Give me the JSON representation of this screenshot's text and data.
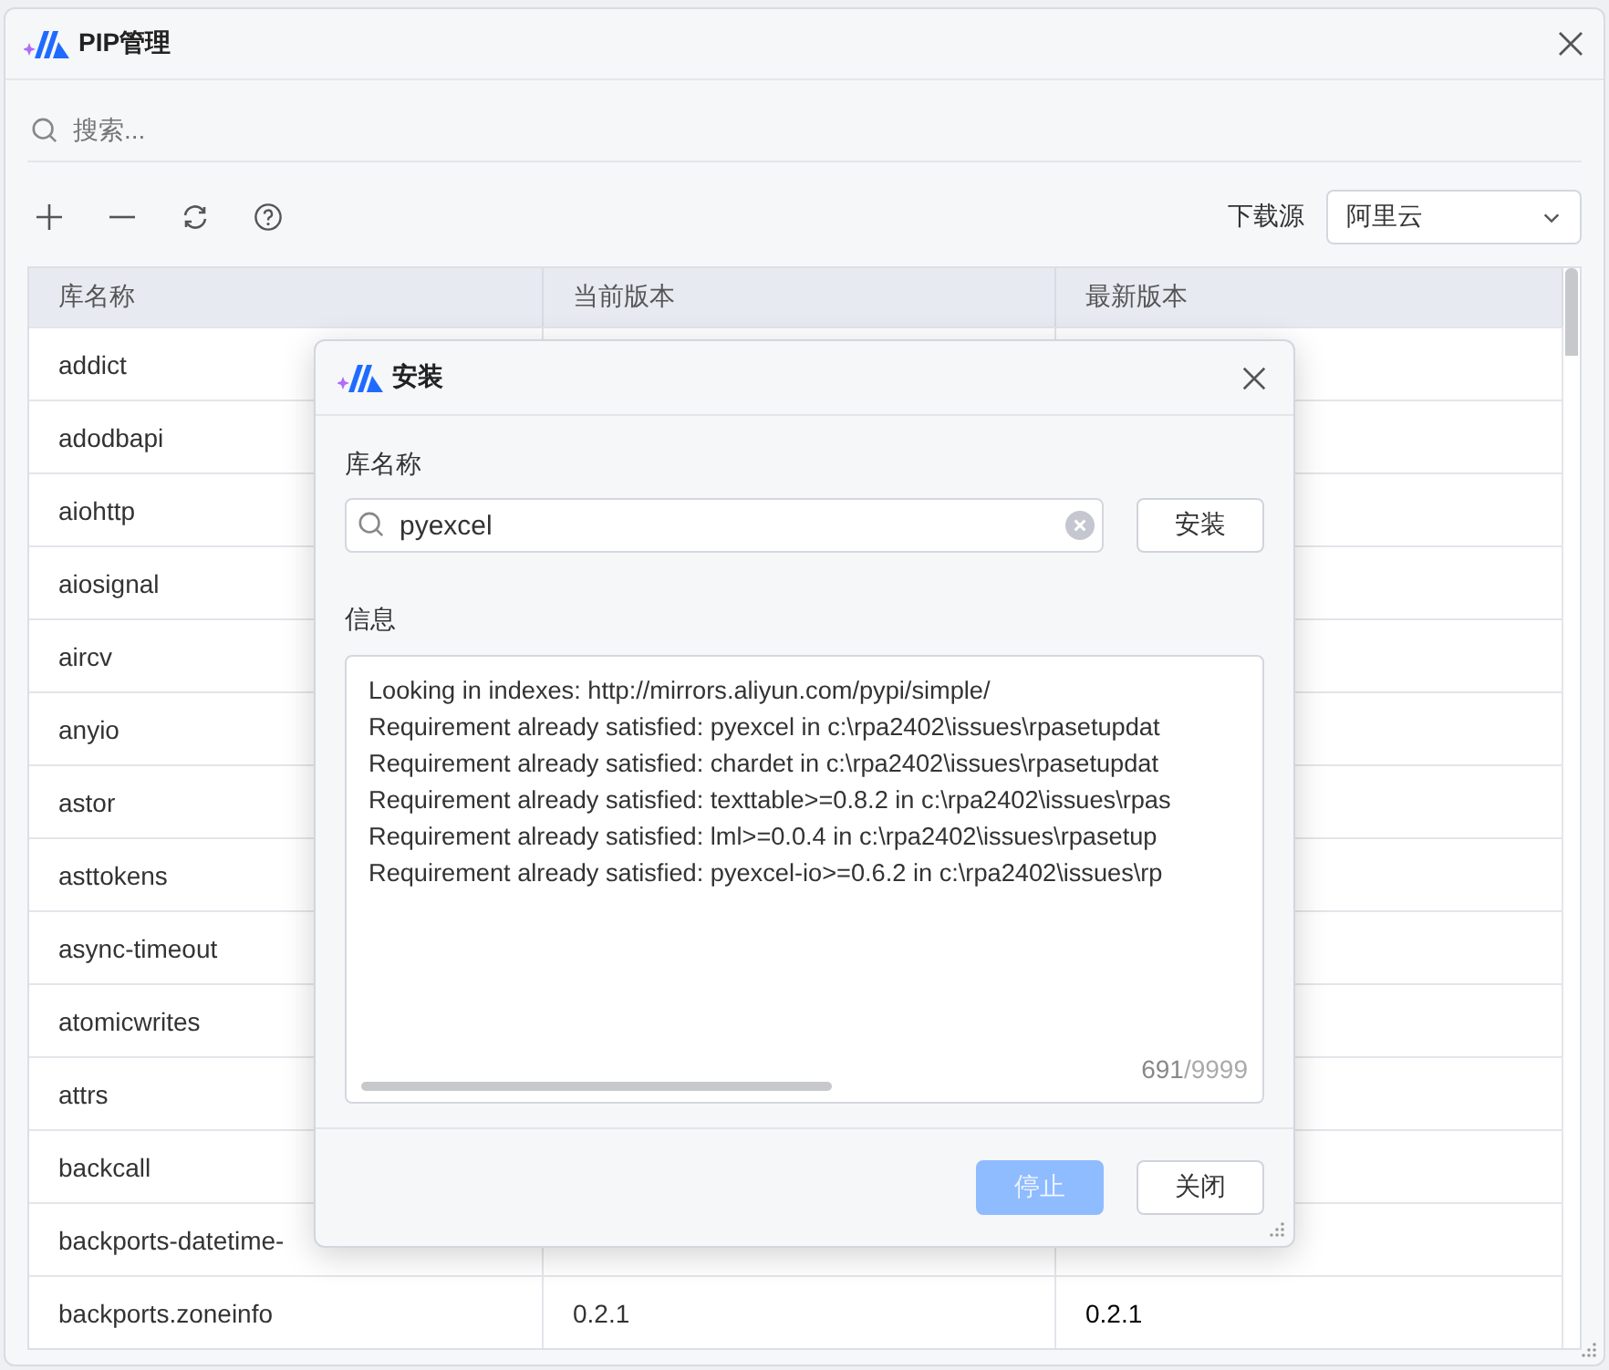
{
  "window": {
    "title": "PIP管理"
  },
  "search": {
    "placeholder": "搜索..."
  },
  "toolbar": {
    "source_label": "下载源",
    "source_value": "阿里云"
  },
  "table": {
    "columns": [
      "库名称",
      "当前版本",
      "最新版本"
    ],
    "rows": [
      {
        "name": "addict"
      },
      {
        "name": "adodbapi"
      },
      {
        "name": "aiohttp"
      },
      {
        "name": "aiosignal"
      },
      {
        "name": "aircv"
      },
      {
        "name": "anyio"
      },
      {
        "name": "astor"
      },
      {
        "name": "asttokens"
      },
      {
        "name": "async-timeout"
      },
      {
        "name": "atomicwrites"
      },
      {
        "name": "attrs"
      },
      {
        "name": "backcall"
      },
      {
        "name": "backports-datetime-"
      },
      {
        "name": "backports.zoneinfo",
        "current": "0.2.1",
        "latest": "0.2.1"
      }
    ]
  },
  "dialog": {
    "title": "安装",
    "field_label": "库名称",
    "field_value": "pyexcel",
    "install_button": "安装",
    "info_label": "信息",
    "log": [
      "Looking in indexes: http://mirrors.aliyun.com/pypi/simple/",
      "Requirement already satisfied: pyexcel in c:\\rpa2402\\issues\\rpasetupdat",
      "Requirement already satisfied: chardet in c:\\rpa2402\\issues\\rpasetupdat",
      "Requirement already satisfied: texttable>=0.8.2 in c:\\rpa2402\\issues\\rpas",
      "Requirement already satisfied: lml>=0.0.4 in c:\\rpa2402\\issues\\rpasetup",
      "Requirement already satisfied: pyexcel-io>=0.6.2 in c:\\rpa2402\\issues\\rp"
    ],
    "count": "691",
    "max": "/9999",
    "buttons": [
      {
        "label": "停止",
        "disabled": true
      },
      {
        "label": "关闭",
        "disabled": false
      }
    ]
  }
}
